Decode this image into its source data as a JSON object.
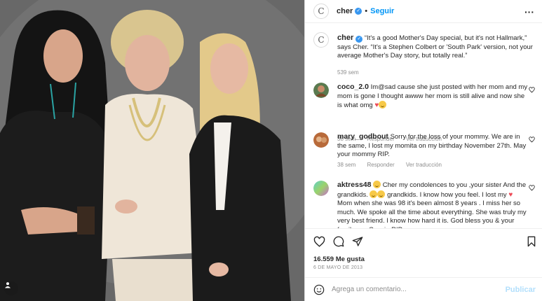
{
  "post": {
    "username": "cher",
    "follow_label": "Seguir",
    "separator": "•",
    "caption_text": "“It's a good Mother's Day special, but it's not Hallmark,” says Cher. “It's a Stephen Colbert or 'South Park' version, not your average Mother's Day story, but totally real.”",
    "caption_time": "539 sem",
    "likes_count": "16.559",
    "likes_label": "Me gusta",
    "date": "6 DE MAYO DE 2013",
    "add_comment_placeholder": "Agrega un comentario...",
    "publish_label": "Publicar"
  },
  "comments": [
    {
      "username": "coco_2.0",
      "text": "Im@sad cause she just posted with her mom and my mom is gone I thought awww her mom is still alive and now she is what omg",
      "time": "38 sem",
      "reply": "Responder",
      "translate": "Ver traducción"
    },
    {
      "username": "mary_godbout",
      "text": "Sorry for the loss of your mommy. We are in the same, I lost my momita on my birthday November 27th. May your mommy RIP.",
      "time": "38 sem",
      "reply": "Responder",
      "translate": "Ver traducción"
    },
    {
      "username": "aktress48",
      "text_a": "Cher my condolences to you ,your sister And the grandkids.",
      "text_b": "grandkids. I know how you feel. I lost my",
      "text_c": "Mom when she was 98 it's been almost 8 years . I miss her so much. We spoke all the time about everything. She was truly my very best friend. I know how hard it is. God bless you & your family xox Cousin RIP"
    }
  ],
  "icons": {
    "logo": "cher-logo-icon",
    "verified": "verified-badge-icon",
    "more": "more-options-icon",
    "heart": "heart-icon",
    "comment": "comment-icon",
    "share": "share-icon",
    "save": "bookmark-icon",
    "emoji": "emoji-icon",
    "tag": "user-tag-icon"
  },
  "colors": {
    "accent": "#0095f6",
    "verified": "#3897f0",
    "muted": "#8e8e8e",
    "publish_disabled": "#b2dffc"
  }
}
